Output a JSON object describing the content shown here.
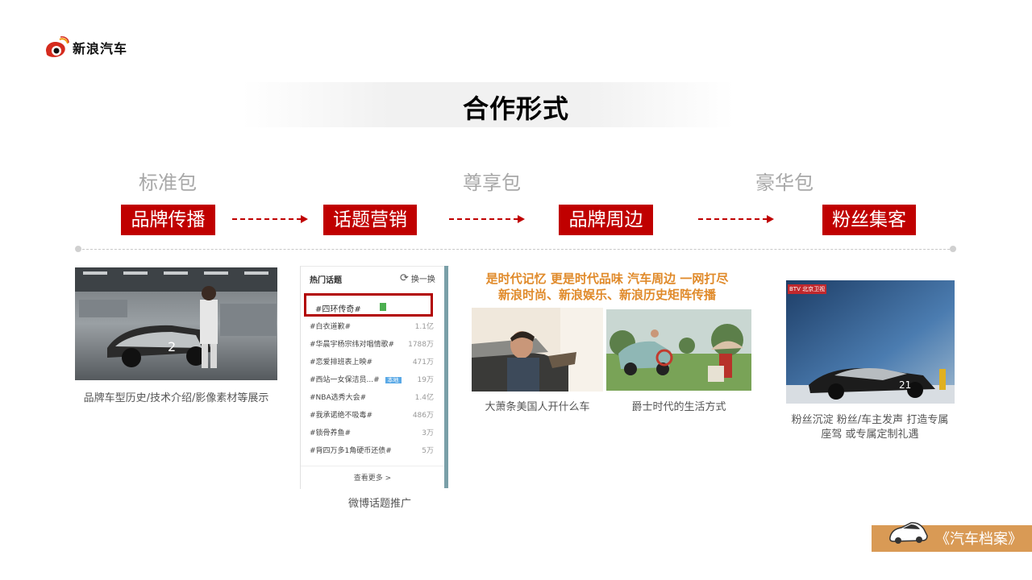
{
  "brand": {
    "name": "新浪汽车",
    "icon": "sina-eye-logo-icon"
  },
  "title": "合作形式",
  "tiers": [
    "标准包",
    "尊享包",
    "豪华包"
  ],
  "forms": [
    "品牌传播",
    "话题营销",
    "品牌周边",
    "粉丝集客"
  ],
  "colors": {
    "accent": "#c00000",
    "orange": "#e08a2a",
    "footer": "#d99a55"
  },
  "sections": {
    "brand_spread": {
      "caption": "品牌车型历史/技术介绍/影像素材等展示"
    },
    "topic": {
      "caption": "微博话题推广",
      "panel": {
        "header": "热门话题",
        "refresh": "换一换",
        "highlight": "#四环传奇#",
        "topics": [
          {
            "name": "#白衣道歉#",
            "count": "1.1亿"
          },
          {
            "name": "#华晨宇杨宗纬对唱情歌#",
            "count": "1788万"
          },
          {
            "name": "#恋爱排班表上映#",
            "count": "471万"
          },
          {
            "name": "#西站一女保洁员...#",
            "count": "19万",
            "badge": "本地"
          },
          {
            "name": "#NBA选秀大会#",
            "count": "1.4亿"
          },
          {
            "name": "#我承诺绝不吸毒#",
            "count": "486万"
          },
          {
            "name": "#锁骨养鱼#",
            "count": "3万"
          },
          {
            "name": "#背四万多1角硬币还债#",
            "count": "5万"
          }
        ],
        "more": "查看更多 >"
      }
    },
    "merch": {
      "headline1": "是时代记忆 更是时代品味 汽车周边 一网打尽",
      "headline2": "新浪时尚、新浪娱乐、新浪历史矩阵传播",
      "caption1": "大萧条美国人开什么车",
      "caption2": "爵士时代的生活方式"
    },
    "fans": {
      "caption1": "粉丝沉淀 粉丝/车主发声 打造专属",
      "caption2": "座驾 或专属定制礼遇",
      "tv_logo": "BTV 北京卫视"
    }
  },
  "footer": {
    "text": "《汽车档案》",
    "icon": "car-icon"
  }
}
